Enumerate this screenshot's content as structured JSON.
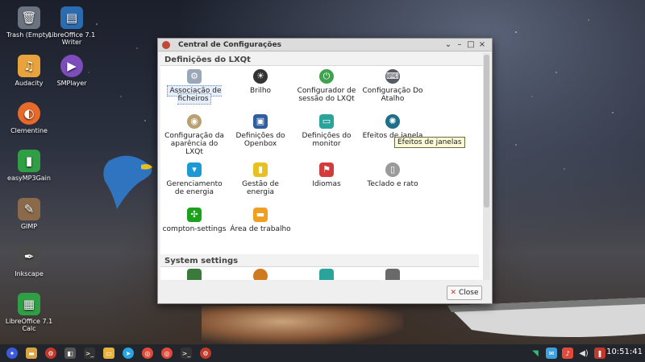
{
  "desktop": {
    "icons": [
      {
        "label": "Trash (Empty)",
        "icon": "trash-icon",
        "color": "#6b7280"
      },
      {
        "label": "LibreOffice 7.1 Writer",
        "icon": "writer-icon",
        "color": "#2b6cb0"
      },
      {
        "label": "Audacity",
        "icon": "audacity-icon",
        "color": "#e8a33d"
      },
      {
        "label": "SMPlayer",
        "icon": "smplayer-icon",
        "color": "#7c4dbb"
      },
      {
        "label": "Clementine",
        "icon": "clementine-icon",
        "color": "#e86a2a"
      },
      {
        "label": "easyMP3Gain",
        "icon": "easymp3gain-icon",
        "color": "#2f9e44"
      },
      {
        "label": "GIMP",
        "icon": "gimp-icon",
        "color": "#8a6a4a"
      },
      {
        "label": "Inkscape",
        "icon": "inkscape-icon",
        "color": "#4a4a4a"
      },
      {
        "label": "LibreOffice 7.1 Calc",
        "icon": "calc-icon",
        "color": "#2f9e44"
      }
    ]
  },
  "window": {
    "title": "Central de Configurações",
    "section1": "Definições do LXQt",
    "section2": "System settings",
    "items": [
      {
        "label": "Associação de ficheiros",
        "icon": "file-association-icon",
        "color": "#9aa7b8"
      },
      {
        "label": "Brilho",
        "icon": "brightness-icon",
        "color": "#333333"
      },
      {
        "label": "Configurador de sessão do LXQt",
        "icon": "power-icon",
        "color": "#3fa34d"
      },
      {
        "label": "Configuração Do Atalho",
        "icon": "keyboard-icon",
        "color": "#555a63"
      },
      {
        "label": "Configuração da aparência do LXQt",
        "icon": "appearance-icon",
        "color": "#b8a070"
      },
      {
        "label": "Definições do Openbox",
        "icon": "openbox-icon",
        "color": "#2f5f9e"
      },
      {
        "label": "Definições do monitor",
        "icon": "monitor-icon",
        "color": "#2aa39a"
      },
      {
        "label": "Efeitos de janela",
        "icon": "window-effects-icon",
        "color": "#1f6f8a"
      },
      {
        "label": "Gerenciamento de energia",
        "icon": "power-management-icon",
        "color": "#1c9ad6"
      },
      {
        "label": "Gestão de energia",
        "icon": "battery-icon",
        "color": "#e8c020"
      },
      {
        "label": "Idiomas",
        "icon": "flag-icon",
        "color": "#d23b3b"
      },
      {
        "label": "Teclado e rato",
        "icon": "mouse-icon",
        "color": "#9a9a9a"
      },
      {
        "label": "compton-settings",
        "icon": "compton-icon",
        "color": "#1aa31a"
      },
      {
        "label": "Área de trabalho",
        "icon": "desktop-folder-icon",
        "color": "#f0a020"
      }
    ],
    "system_items": [
      {
        "icon": "system-item-1-icon",
        "color": "#3a7a3a"
      },
      {
        "icon": "system-item-2-icon",
        "color": "#d07a20"
      },
      {
        "icon": "system-item-3-icon",
        "color": "#2aa39a"
      },
      {
        "icon": "system-item-4-icon",
        "color": "#6a6a6a"
      }
    ],
    "tooltip": "Efeitos de janelas",
    "close_label": "Close"
  },
  "taskbar": {
    "clock": "10:51:41",
    "left_icons": [
      {
        "icon": "start-menu-icon",
        "color": "#3b5bdb"
      },
      {
        "icon": "file-manager-icon",
        "color": "#d9a441"
      },
      {
        "icon": "settings-center-icon",
        "color": "#c0392b"
      },
      {
        "icon": "toggle-icon",
        "color": "#555555"
      },
      {
        "icon": "terminal-icon",
        "color": "#333333"
      },
      {
        "icon": "folder-icon",
        "color": "#e8b33d"
      },
      {
        "icon": "telegram-icon",
        "color": "#2aa3e0"
      },
      {
        "icon": "chrome-icon",
        "color": "#e04a3a"
      },
      {
        "icon": "chrome-icon-2",
        "color": "#e04a3a"
      },
      {
        "icon": "terminal-icon-2",
        "color": "#333333"
      },
      {
        "icon": "settings-window-icon",
        "color": "#c0392b"
      }
    ],
    "tray_icons": [
      {
        "icon": "wifi-icon",
        "color": "#2fbf71"
      },
      {
        "icon": "chat-icon",
        "color": "#3fa0e0"
      },
      {
        "icon": "notification-icon",
        "color": "#e04a3a"
      },
      {
        "icon": "volume-icon",
        "color": "#dddddd"
      },
      {
        "icon": "app-tray-icon",
        "color": "#c0392b"
      }
    ]
  }
}
